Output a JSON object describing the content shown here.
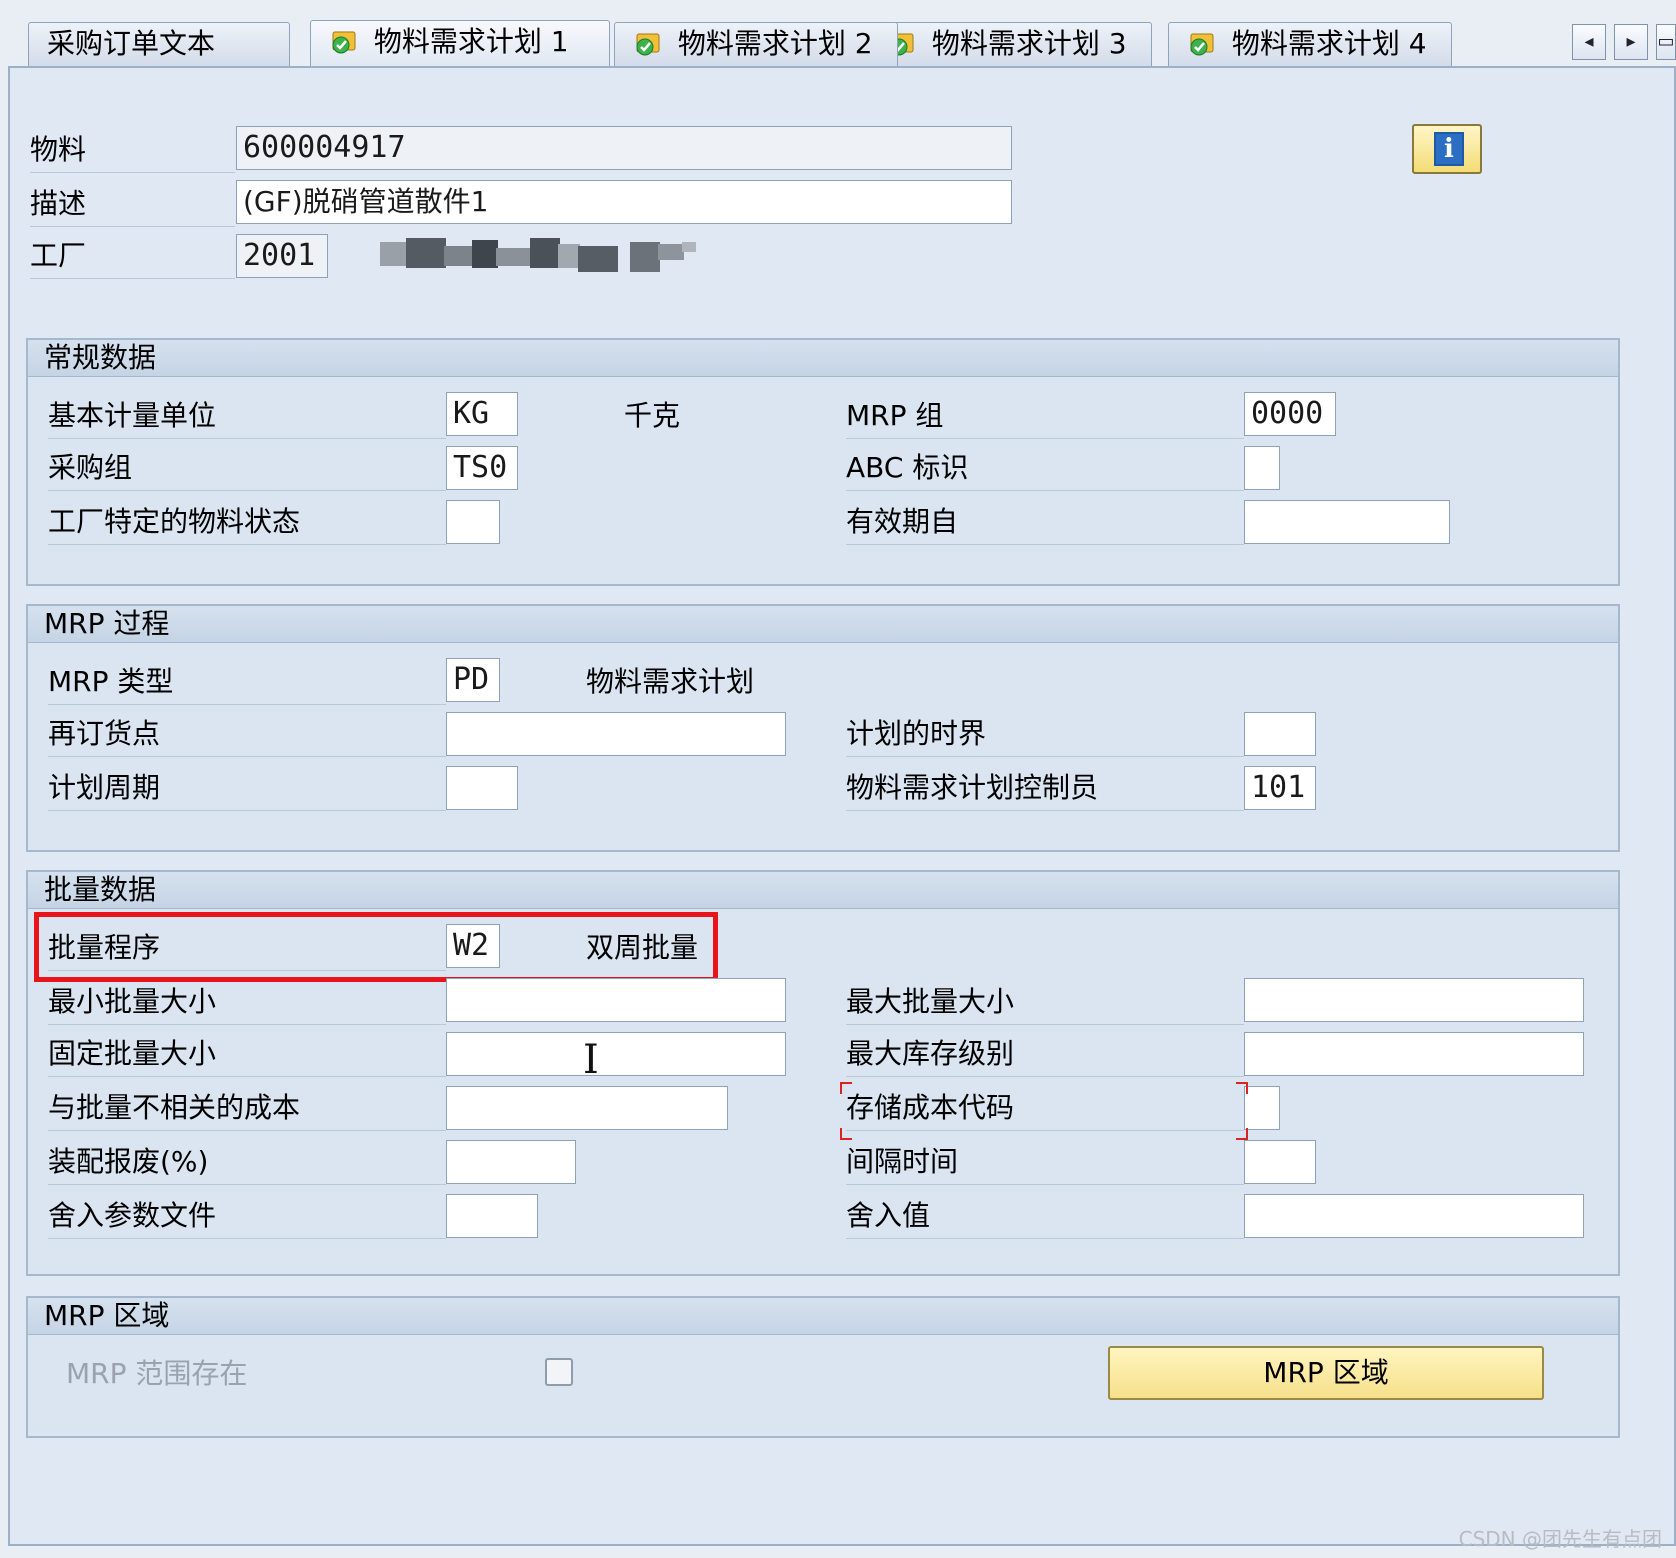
{
  "tabs": [
    {
      "label": "采购订单文本",
      "active": false,
      "icon": false
    },
    {
      "label": "物料需求计划 1",
      "active": true,
      "icon": true
    },
    {
      "label": "物料需求计划 2",
      "active": false,
      "icon": true
    },
    {
      "label": "物料需求计划 3",
      "active": false,
      "icon": true
    },
    {
      "label": "物料需求计划 4",
      "active": false,
      "icon": true
    }
  ],
  "tab_nav": {
    "prev": "◂",
    "next": "▸",
    "menu": "▭"
  },
  "header": {
    "material_label": "物料",
    "material_value": "600004917",
    "desc_label": "描述",
    "desc_value": "(GF)脱硝管道散件1",
    "plant_label": "工厂",
    "plant_value": "2001",
    "info_icon": "info-icon",
    "info_glyph": "i"
  },
  "general": {
    "title": "常规数据",
    "base_uom_label": "基本计量单位",
    "base_uom_value": "KG",
    "base_uom_text": "千克",
    "mrp_group_label": "MRP 组",
    "mrp_group_value": "0000",
    "purch_group_label": "采购组",
    "purch_group_value": "TS0",
    "abc_label": "ABC 标识",
    "abc_value": "",
    "plant_status_label": "工厂特定的物料状态",
    "plant_status_value": "",
    "valid_from_label": "有效期自",
    "valid_from_value": ""
  },
  "mrp_proc": {
    "title": "MRP 过程",
    "mrp_type_label": "MRP 类型",
    "mrp_type_value": "PD",
    "mrp_type_text": "物料需求计划",
    "reorder_label": "再订货点",
    "reorder_value": "",
    "time_fence_label": "计划的时界",
    "time_fence_value": "",
    "cycle_label": "计划周期",
    "cycle_value": "",
    "controller_label": "物料需求计划控制员",
    "controller_value": "101"
  },
  "lot": {
    "title": "批量数据",
    "lot_proc_label": "批量程序",
    "lot_proc_value": "W2",
    "lot_proc_text": "双周批量",
    "min_label": "最小批量大小",
    "min_value": "",
    "max_label": "最大批量大小",
    "max_value": "",
    "fixed_label": "固定批量大小",
    "fixed_value": "",
    "max_stock_label": "最大库存级别",
    "max_stock_value": "",
    "ind_cost_label": "与批量不相关的成本",
    "ind_cost_value": "",
    "storage_cost_label": "存储成本代码",
    "storage_cost_value": "",
    "scrap_label": "装配报废(%)",
    "scrap_value": "",
    "takt_label": "间隔时间",
    "takt_value": "",
    "round_prof_label": "舍入参数文件",
    "round_prof_value": "",
    "round_val_label": "舍入值",
    "round_val_value": ""
  },
  "mrp_area": {
    "title": "MRP 区域",
    "exists_label": "MRP  范围存在",
    "exists_checked": false,
    "button_label": "MRP 区域"
  },
  "watermark": "CSDN @团先生有点团",
  "colors": {
    "highlight": "#e8141b",
    "button": "#f6e08a"
  }
}
